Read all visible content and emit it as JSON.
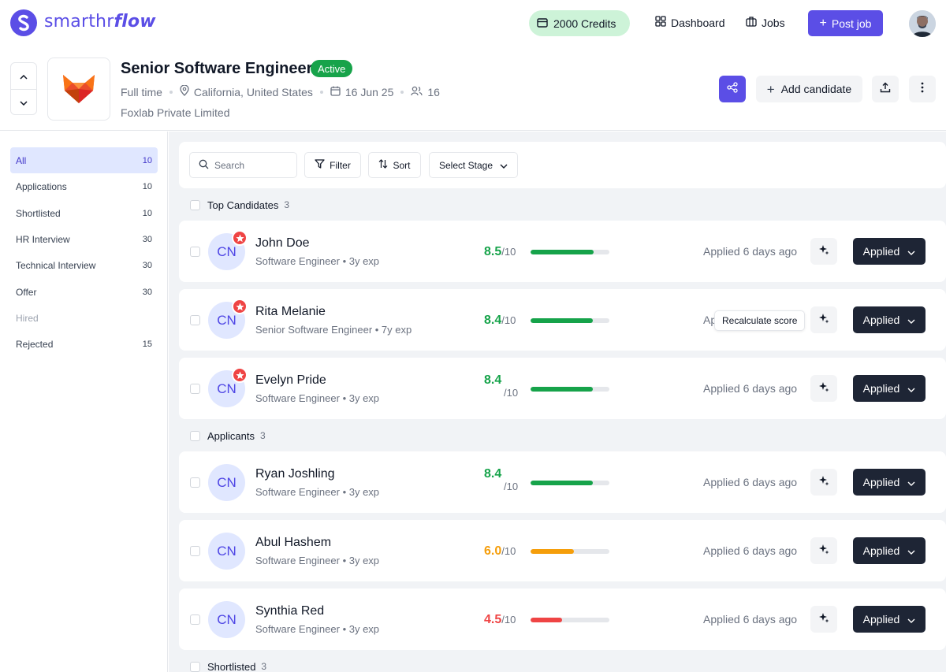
{
  "app": {
    "logo_text_light": "smarthr",
    "logo_text_bold": "flow",
    "credits_label": "2000 Credits",
    "nav": {
      "dashboard": "Dashboard",
      "jobs": "Jobs",
      "post_job": "Post job"
    }
  },
  "job": {
    "title": "Senior Software Engineer",
    "status": "Active",
    "employment_type": "Full time",
    "location": "California, United States",
    "date": "16 Jun 25",
    "applicants": "16",
    "company": "Foxlab Private Limited",
    "add_candidate_label": "Add candidate"
  },
  "sidebar": {
    "items": [
      {
        "label": "All",
        "count": "10"
      },
      {
        "label": "Applications",
        "count": "10"
      },
      {
        "label": "Shortlisted",
        "count": "10"
      },
      {
        "label": "HR Interview",
        "count": "30"
      },
      {
        "label": "Technical Interview",
        "count": "30"
      },
      {
        "label": "Offer",
        "count": "30"
      },
      {
        "label": "Hired",
        "count": ""
      },
      {
        "label": "Rejected",
        "count": "15"
      }
    ]
  },
  "toolbar": {
    "search_placeholder": "Search",
    "filter_label": "Filter",
    "sort_label": "Sort",
    "stage_label": "Select Stage"
  },
  "sections": [
    {
      "title": "Top Candidates",
      "count": "3"
    },
    {
      "title": "Applicants",
      "count": "3"
    },
    {
      "title": "Shortlisted",
      "count": "3"
    }
  ],
  "candidates": [
    {
      "initials": "CN",
      "name": "John Doe",
      "role": "Software Engineer • 3y exp",
      "score": "8.5",
      "score_value": 8.5,
      "score_den": "/10",
      "applied": "Applied 6 days ago",
      "stage": "Applied",
      "color": "#16a34a"
    },
    {
      "initials": "CN",
      "name": "Rita Melanie",
      "role": "Senior Software Engineer • 7y exp",
      "score": "8.4",
      "score_value": 8.4,
      "score_den": "/10",
      "applied": "Ap",
      "stage": "Applied",
      "color": "#16a34a",
      "tooltip": "Recalculate score"
    },
    {
      "initials": "CN",
      "name": "Evelyn Pride",
      "role": "Software Engineer • 3y exp",
      "score": "8.4",
      "score_value": 8.4,
      "score_den": "/10",
      "applied": "Applied 6 days ago",
      "stage": "Applied",
      "color": "#16a34a"
    },
    {
      "initials": "CN",
      "name": "Ryan Joshling",
      "role": "Software Engineer • 3y exp",
      "score": "8.4",
      "score_value": 8.4,
      "score_den": "/10",
      "applied": "Applied 6 days ago",
      "stage": "Applied",
      "color": "#16a34a"
    },
    {
      "initials": "CN",
      "name": "Abul Hashem",
      "role": "Software Engineer • 3y exp",
      "score": "6.0",
      "score_value": 6.0,
      "score_den": "/10",
      "applied": "Applied 6 days ago",
      "stage": "Applied",
      "color": "#f59e0b"
    },
    {
      "initials": "CN",
      "name": "Synthia Red",
      "role": "Software Engineer • 3y exp",
      "score": "4.5",
      "score_value": 4.5,
      "score_den": "/10",
      "applied": "Applied 6 days ago",
      "stage": "Applied",
      "color": "#ef4444"
    }
  ],
  "colors": {
    "brand": "#5b4ee6",
    "active": "#17a34a",
    "stage_button": "#1e2535"
  }
}
